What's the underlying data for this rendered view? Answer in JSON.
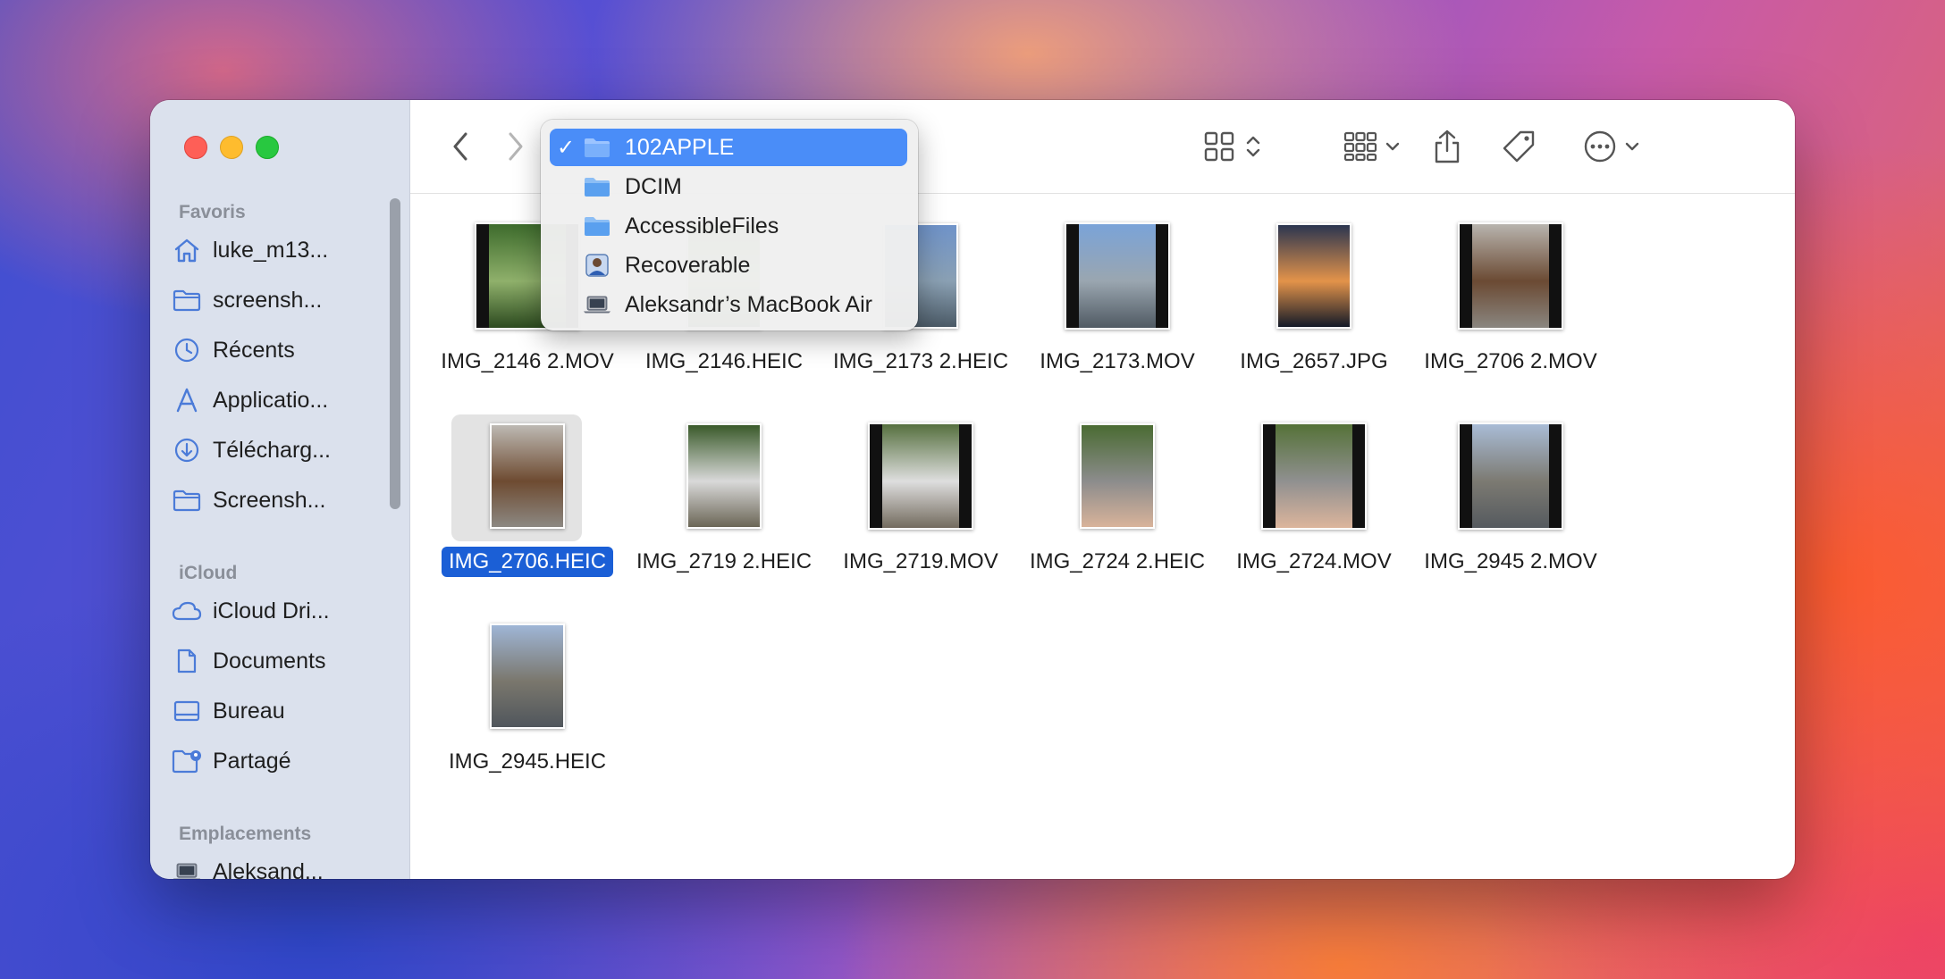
{
  "sidebar": {
    "sections": [
      {
        "heading": "Favoris",
        "items": [
          {
            "label": "luke_m13...",
            "icon": "home-icon"
          },
          {
            "label": "screensh...",
            "icon": "folder-icon"
          },
          {
            "label": "Récents",
            "icon": "clock-icon"
          },
          {
            "label": "Applicatio...",
            "icon": "applications-icon"
          },
          {
            "label": "Télécharg...",
            "icon": "download-icon"
          },
          {
            "label": "Screensh...",
            "icon": "folder-icon"
          }
        ]
      },
      {
        "heading": "iCloud",
        "items": [
          {
            "label": "iCloud Dri...",
            "icon": "cloud-icon"
          },
          {
            "label": "Documents",
            "icon": "document-icon"
          },
          {
            "label": "Bureau",
            "icon": "desktop-icon"
          },
          {
            "label": "Partagé",
            "icon": "shared-folder-icon"
          }
        ]
      },
      {
        "heading": "Emplacements",
        "items": [
          {
            "label": "Aleksand...",
            "icon": "laptop-icon"
          }
        ]
      }
    ]
  },
  "path_menu": {
    "items": [
      {
        "label": "102APPLE",
        "icon": "folder-icon",
        "checked": true
      },
      {
        "label": "DCIM",
        "icon": "folder-icon",
        "checked": false
      },
      {
        "label": "AccessibleFiles",
        "icon": "folder-icon",
        "checked": false
      },
      {
        "label": "Recoverable",
        "icon": "user-avatar-icon",
        "checked": false
      },
      {
        "label": "Aleksandr’s MacBook Air",
        "icon": "laptop-icon",
        "checked": false
      }
    ],
    "check_glyph": "✓"
  },
  "files": [
    {
      "name": "IMG_2146 2.MOV",
      "kind": "video",
      "colors": [
        "#3d6b2c",
        "#8fb06b",
        "#2c4a1f"
      ]
    },
    {
      "name": "IMG_2146.HEIC",
      "kind": "photo",
      "colors": [
        "#4e7a33",
        "#9cbf73",
        "#2f5220"
      ]
    },
    {
      "name": "IMG_2173 2.HEIC",
      "kind": "photo",
      "colors": [
        "#6f93c9",
        "#8aa0b3",
        "#4b5a66"
      ]
    },
    {
      "name": "IMG_2173.MOV",
      "kind": "video",
      "colors": [
        "#7aa3d8",
        "#9aa6b0",
        "#505a63"
      ]
    },
    {
      "name": "IMG_2657.JPG",
      "kind": "photo",
      "colors": [
        "#2b3550",
        "#e3934a",
        "#141a28"
      ]
    },
    {
      "name": "IMG_2706 2.MOV",
      "kind": "video",
      "colors": [
        "#b8b4ae",
        "#6b4a33",
        "#8a8680"
      ]
    },
    {
      "name": "IMG_2706.HEIC",
      "kind": "photo",
      "colors": [
        "#bdb9b3",
        "#6e4b31",
        "#8c8882"
      ],
      "selected": true
    },
    {
      "name": "IMG_2719 2.HEIC",
      "kind": "photo",
      "colors": [
        "#3a5a2a",
        "#d9d9d9",
        "#6b6656"
      ]
    },
    {
      "name": "IMG_2719.MOV",
      "kind": "video",
      "colors": [
        "#56703f",
        "#dedede",
        "#736b5e"
      ]
    },
    {
      "name": "IMG_2724 2.HEIC",
      "kind": "photo",
      "colors": [
        "#4a6b32",
        "#8c8c8c",
        "#d8b39a"
      ]
    },
    {
      "name": "IMG_2724.MOV",
      "kind": "video",
      "colors": [
        "#557238",
        "#909090",
        "#dcb59c"
      ]
    },
    {
      "name": "IMG_2945 2.MOV",
      "kind": "video",
      "colors": [
        "#a9bcd6",
        "#7c7a72",
        "#555a5f"
      ]
    },
    {
      "name": "IMG_2945.HEIC",
      "kind": "photo",
      "colors": [
        "#9fb6d6",
        "#7a776d",
        "#50565c"
      ]
    }
  ],
  "accent": "#1b5fd6"
}
